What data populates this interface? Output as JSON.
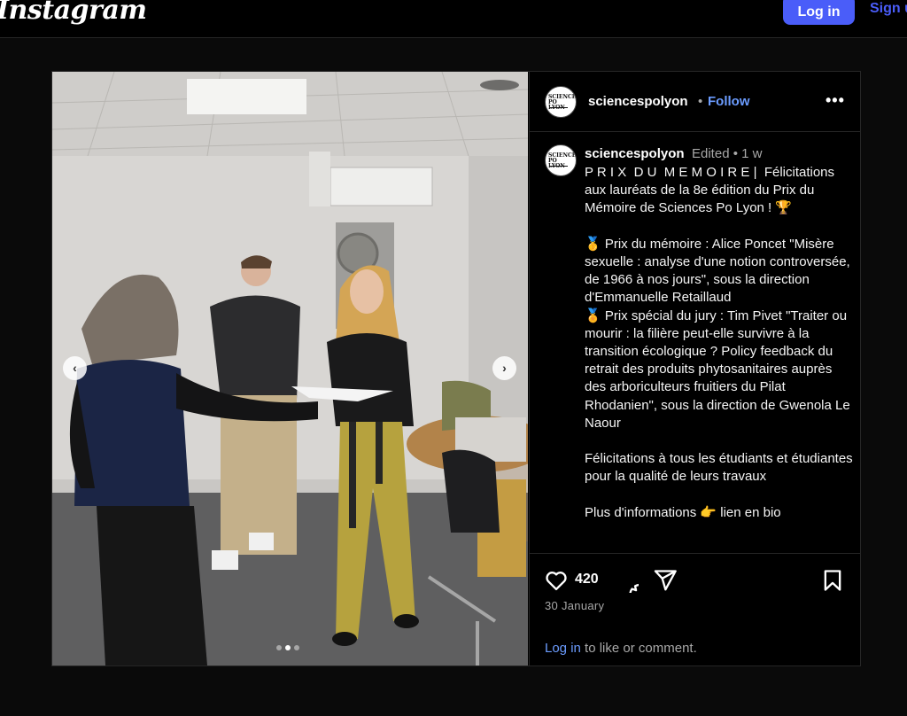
{
  "topbar": {
    "logo": "Instagram",
    "login_label": "Log in",
    "signup_label": "Sign up"
  },
  "post": {
    "username": "sciencespolyon",
    "separator": "•",
    "follow_label": "Follow",
    "more_label": "•••",
    "avatar_text": "SCIENCES PO LYON",
    "edited_meta": "Edited  •  1 w",
    "caption": "P R I X  D U  M E M O I R E |  Félicitations aux lauréats de la 8e édition du Prix du Mémoire de Sciences Po Lyon ! 🏆\n\n🥇 Prix du mémoire : Alice Poncet \"Misère sexuelle : analyse d'une notion controversée, de 1966 à nos jours\", sous la direction d'Emmanuelle Retaillaud\n🏅 Prix spécial du jury : Tim Pivet \"Traiter ou mourir : la filière peut-elle survivre à la transition écologique ? Policy feedback du retrait des produits phytosanitaires auprès des arboriculteurs fruitiers du Pilat Rhodanien\", sous la direction de Gwenola Le Naour\n\nFélicitations à tous les étudiants et étudiantes pour la qualité de leurs travaux\n\nPlus d'informations 👉 lien en bio",
    "like_count": "420",
    "date": "30 January",
    "login_link": "Log in",
    "login_suffix": " to like or comment.",
    "carousel": {
      "slides": 3,
      "active": 1
    },
    "prev_label": "‹",
    "next_label": "›"
  },
  "colors": {
    "accent": "#4a5df9",
    "link": "#6b9cff",
    "background": "#000000",
    "muted": "#a8a8a8"
  },
  "icons": [
    "heart-icon",
    "comment-icon",
    "share-icon",
    "bookmark-icon",
    "more-icon",
    "chevron-left-icon",
    "chevron-right-icon"
  ]
}
